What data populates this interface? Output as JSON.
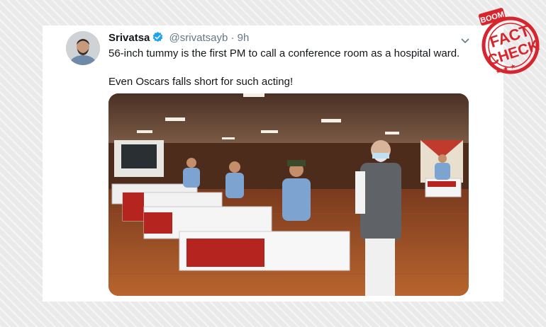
{
  "tweet": {
    "display_name": "Srivatsa",
    "handle": "@srivatsayb",
    "separator": "·",
    "time": "9h",
    "text_line1": "56-inch tummy is the first PM to call a conference room as a hospital ward.",
    "text_line2": "Even Oscars falls short for such acting!",
    "media_alt": "Photo of a hospital ward with patients sitting on beds"
  },
  "stamp": {
    "brand": "BOOM",
    "line1": "FACT",
    "line2": "CHECK",
    "color": "#d7252d"
  },
  "icons": {
    "verified": "verified-badge-icon",
    "menu": "chevron-down-icon"
  },
  "colors": {
    "twitter_blue": "#1da1f2",
    "text_primary": "#14171a",
    "text_secondary": "#657786"
  }
}
